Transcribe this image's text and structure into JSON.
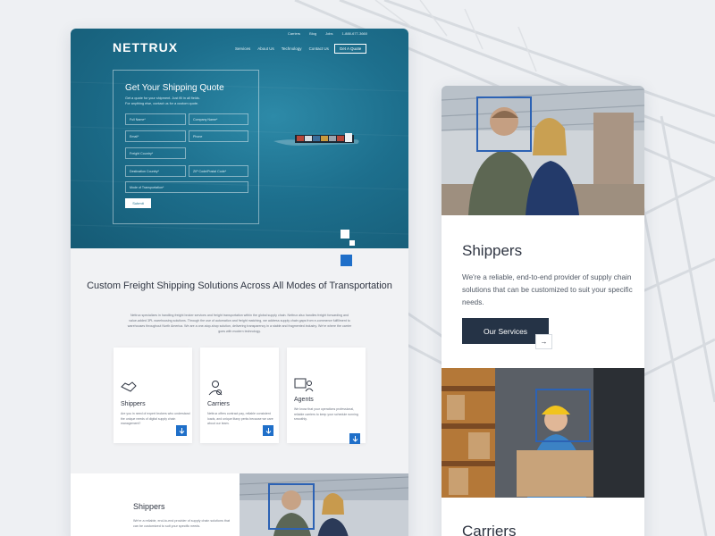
{
  "site": {
    "logo": "NETTRUX",
    "topbar": [
      "Carriers",
      "Blog",
      "Jobs",
      "1-888-677-3660"
    ],
    "nav": [
      "Services",
      "About Us",
      "Technology",
      "Contact Us"
    ],
    "quote_button": "Get A Quote"
  },
  "quote_form": {
    "title": "Get Your Shipping Quote",
    "subtitle": "Get a quote for your shipment. Just fill in all fields.",
    "subtitle2": "For anything else, contact us for a custom quote.",
    "fields": {
      "full_name": "Full Name*",
      "company_name": "Company Name*",
      "email": "Email*",
      "phone": "Phone",
      "freight_country": "Freight Country*",
      "destination_country": "Destination Country*",
      "zip": "ZIP Code/Postal Code*",
      "mode": "Mode of Transportation*"
    },
    "submit": "Submit"
  },
  "intro": {
    "title": "Custom Freight Shipping Solutions Across All Modes of Transportation",
    "paragraph": "Nettrux specializes in handling freight broker services and freight transportation within the global supply chain. Nettrux also handles freight forwarding and value-added 3PL warehousing solutions. Through the use of automation and freight matching, we address supply chain gaps from e-commerce fulfillment to warehouses throughout North America. We are a one-stop-shop solution, delivering transparency in a stable and fragmented industry. We're where the carrier goes with modern technology."
  },
  "cards": [
    {
      "title": "Shippers",
      "text": "Are you in need of expert brokers who understand the unique needs of digital supply chain management?",
      "icon": "handshake-icon"
    },
    {
      "title": "Carriers",
      "text": "Nettrux offers contract pay, reliable consistent loads, and unique litany perks because we care about our team.",
      "icon": "driver-icon"
    },
    {
      "title": "Agents",
      "text": "We know that your operations professional, reliable carriers to keep your schedule running smoothly.",
      "icon": "agent-icon"
    }
  ],
  "shippers_section": {
    "title": "Shippers",
    "text": "We're a reliable, end-to-end provider of supply chain solutions that can be customized to suit your specific needs."
  },
  "mobile": {
    "title": "Shippers",
    "text": "We're a reliable, end-to-end provider of supply chain solutions that can be customized to suit your specific needs.",
    "button": "Our Services",
    "arrow": "→",
    "title2": "Carriers"
  }
}
